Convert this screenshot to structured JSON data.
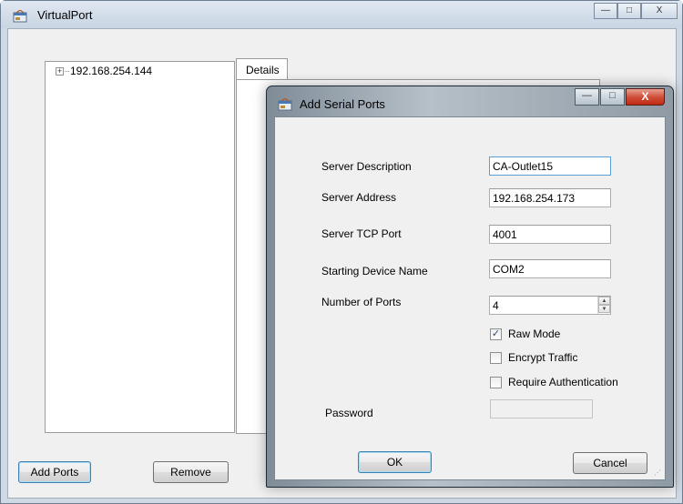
{
  "main_window": {
    "title": "VirtualPort",
    "caption": {
      "minimize": "—",
      "maximize": "□",
      "close": "X"
    },
    "tree": {
      "expander": "+",
      "node_label": "192.168.254.144"
    },
    "details_tab": "Details",
    "buttons": {
      "add_ports": "Add Ports",
      "remove": "Remove"
    }
  },
  "dialog": {
    "title": "Add Serial Ports",
    "caption": {
      "minimize": "—",
      "maximize": "□",
      "close": "X"
    },
    "fields": {
      "server_description": {
        "label": "Server Description",
        "value": "CA-Outlet15"
      },
      "server_address": {
        "label": "Server Address",
        "value": "192.168.254.173"
      },
      "server_tcp_port": {
        "label": "Server TCP Port",
        "value": "4001"
      },
      "starting_device_name": {
        "label": "Starting Device Name",
        "value": "COM2"
      },
      "number_of_ports": {
        "label": "Number of Ports",
        "value": "4"
      },
      "password": {
        "label": "Password",
        "value": ""
      }
    },
    "checkboxes": {
      "raw_mode": {
        "label": "Raw Mode",
        "checked": true,
        "mark": "✓"
      },
      "encrypt_traffic": {
        "label": "Encrypt Traffic",
        "checked": false,
        "mark": ""
      },
      "require_authentication": {
        "label": "Require Authentication",
        "checked": false,
        "mark": ""
      }
    },
    "buttons": {
      "ok": "OK",
      "cancel": "Cancel"
    }
  },
  "icons": {
    "app": "window-app-icon",
    "spinner_up": "▲",
    "spinner_down": "▼"
  },
  "colors": {
    "window_frame": "#cfd8e3",
    "dialog_frame": "#9aa5af",
    "client_bg": "#f0f0f0",
    "close_button": "#c12a14"
  }
}
